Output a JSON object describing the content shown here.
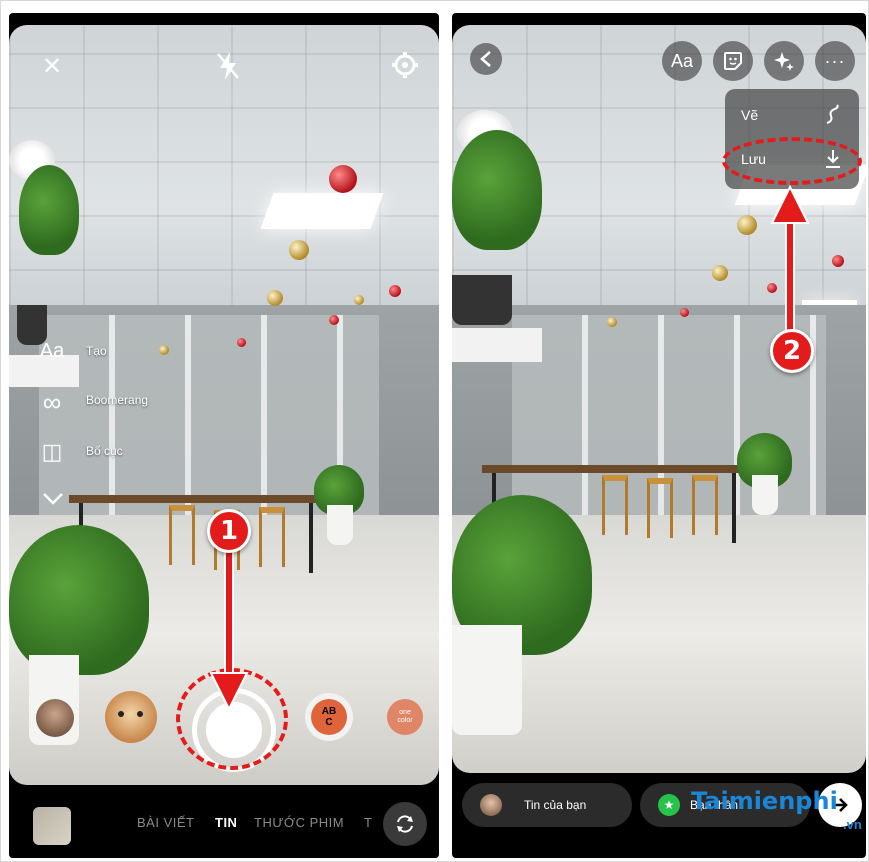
{
  "left_screen": {
    "tools": [
      {
        "icon": "text-aa-icon",
        "glyph": "Aa",
        "label": "Tạo"
      },
      {
        "icon": "infinity-icon",
        "glyph": "∞",
        "label": "Boomerang"
      },
      {
        "icon": "layout-grid-icon",
        "glyph": "◫",
        "label": "Bố cục"
      }
    ],
    "effect_abc": "ABC",
    "effect_one_color": "one color",
    "modes": [
      "BÀI VIẾT",
      "TIN",
      "THƯỚC PHIM",
      "T"
    ],
    "active_mode": "TIN",
    "step_marker": "1"
  },
  "right_screen": {
    "text_tool": "Aa",
    "menu": [
      {
        "label": "Vẽ",
        "icon": "squiggle-icon"
      },
      {
        "label": "Lưu",
        "icon": "download-icon"
      }
    ],
    "step_marker": "2",
    "share_your_story": "Tin của bạn",
    "share_close_friends": "Bạn thân"
  },
  "watermark": {
    "brand": "Taimienphi",
    "domain": ".vn"
  },
  "colors": {
    "annotation_red": "#e41b1b",
    "watermark_blue": "#1c86d6"
  }
}
